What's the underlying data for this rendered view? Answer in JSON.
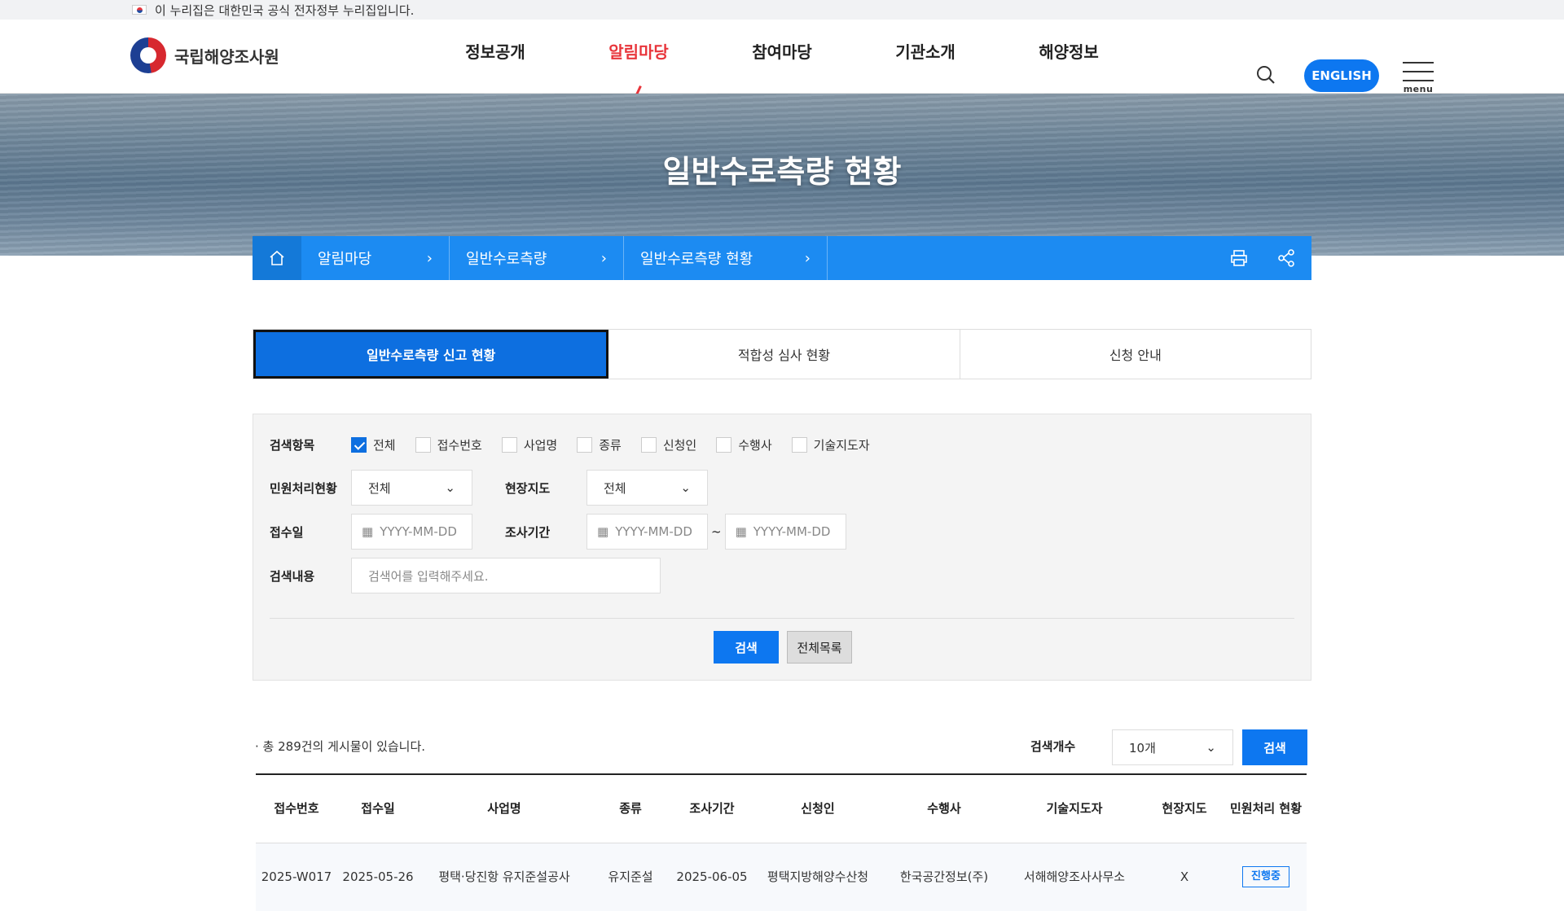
{
  "gov_banner": "이 누리집은 대한민국 공식 전자정부 누리집입니다.",
  "logo": {
    "text": "국립해양조사원"
  },
  "nav": [
    "정보공개",
    "알림마당",
    "참여마당",
    "기관소개",
    "해양정보"
  ],
  "header": {
    "english": "ENGLISH",
    "menu": "menu"
  },
  "page_title": "일반수로측량 현황",
  "breadcrumb": [
    "알림마당",
    "일반수로측량",
    "일반수로측량 현황"
  ],
  "tabs": [
    "일반수로측량 신고 현황",
    "적합성 심사 현황",
    "신청 안내"
  ],
  "search": {
    "item_label": "검색항목",
    "items": [
      "전체",
      "접수번호",
      "사업명",
      "종류",
      "신청인",
      "수행사",
      "기술지도자"
    ],
    "status_label": "민원처리현황",
    "status_value": "전체",
    "field_label": "현장지도",
    "field_value": "전체",
    "receipt_label": "접수일",
    "period_label": "조사기간",
    "date_placeholder": "YYYY-MM-DD",
    "tilde": "~",
    "content_label": "검색내용",
    "content_placeholder": "검색어를 입력해주세요.",
    "search_btn": "검색",
    "list_btn": "전체목록"
  },
  "list": {
    "total": "· 총 289건의 게시물이 있습니다.",
    "count_label": "검색개수",
    "count_value": "10개",
    "count_btn": "검색",
    "headers": [
      "접수번호",
      "접수일",
      "사업명",
      "종류",
      "조사기간",
      "신청인",
      "수행사",
      "기술지도자",
      "현장지도",
      "민원처리 현황"
    ],
    "rows": [
      [
        "2025-W017",
        "2025-05-26",
        "평택·당진항 유지준설공사",
        "유지준설",
        "2025-06-05",
        "평택지방해양수산청",
        "한국공간정보(주)",
        "서해해양조사사무소",
        "X",
        "진행중"
      ]
    ]
  }
}
